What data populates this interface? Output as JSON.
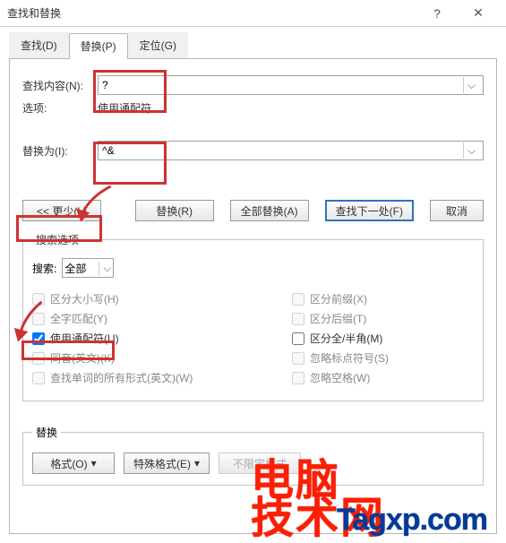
{
  "titlebar": {
    "title": "查找和替换",
    "help": "?",
    "close": "✕"
  },
  "tabs": {
    "find": "查找(D)",
    "replace": "替换(P)",
    "goto": "定位(G)"
  },
  "find": {
    "label": "查找内容(N):",
    "value": "?",
    "options_label": "选项:",
    "options_value": "使用通配符"
  },
  "replace": {
    "label": "替换为(I):",
    "value": "^&"
  },
  "buttons": {
    "less": "<< 更少(L)",
    "replace": "替换(R)",
    "replace_all": "全部替换(A)",
    "find_next": "查找下一处(F)",
    "cancel": "取消"
  },
  "search_options": {
    "legend": "搜索选项",
    "search_label": "搜索:",
    "search_value": "全部",
    "match_case": "区分大小写(H)",
    "whole_word": "全字匹配(Y)",
    "wildcards": "使用通配符(U)",
    "sounds_like": "同音(英文)(K)",
    "all_word_forms": "查找单词的所有形式(英文)(W)",
    "prefix": "区分前缀(X)",
    "suffix": "区分后缀(T)",
    "full_half": "区分全/半角(M)",
    "ignore_punct": "忽略标点符号(S)",
    "ignore_space": "忽略空格(W)"
  },
  "replace_section": {
    "legend": "替换",
    "format": "格式(O)",
    "special": "特殊格式(E)",
    "no_format": "不限定格式"
  },
  "watermark": {
    "text1": "电脑",
    "text2": "技术网",
    "url": "Tagxp.com"
  }
}
